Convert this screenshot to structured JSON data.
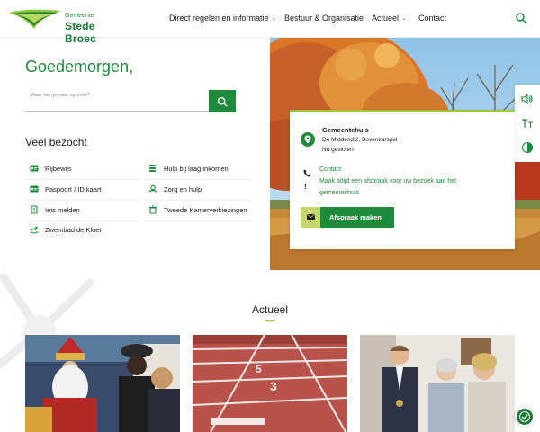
{
  "header": {
    "logo_small": "Gemeente",
    "logo_big": "Stede Broec",
    "nav": [
      {
        "label": "Direct regelen en informatie",
        "has_dropdown": true
      },
      {
        "label": "Bestuur & Organisatie",
        "has_dropdown": false
      },
      {
        "label": "Actueel",
        "has_dropdown": true
      },
      {
        "label": "Contact",
        "has_dropdown": false
      }
    ],
    "search_icon": "search-icon"
  },
  "hero": {
    "greeting": "Goedemorgen,",
    "search_placeholder": "Waar ben je naar op zoek?"
  },
  "meest_bezocht": {
    "title": "Veel bezocht",
    "links": [
      {
        "label": "Rijbewijs",
        "icon": "id-card-icon"
      },
      {
        "label": "Hulp bij laag inkomen",
        "icon": "coins-icon"
      },
      {
        "label": "Paspoort / ID kaart",
        "icon": "id-card-icon"
      },
      {
        "label": "Zorg en hulp",
        "icon": "care-icon"
      },
      {
        "label": "Iets melden",
        "icon": "report-icon"
      },
      {
        "label": "Tweede Kamerverkiezingen",
        "icon": "ballot-box-icon"
      },
      {
        "label": "Zwembad de Kloet",
        "icon": "swimmer-icon"
      }
    ]
  },
  "info_card": {
    "location_name": "Gemeentehuis",
    "address": "De Middend 2, Bovenkarspel",
    "status": "Nu gesloten",
    "contact_label": "Contact",
    "notice_line1": "Maak altijd een afspraak voor uw bezoek aan het",
    "notice_line2": "gemeentehuis",
    "appointment_button": "Afspraak maken"
  },
  "tools": [
    "speaker-icon",
    "text-size-icon",
    "contrast-icon"
  ],
  "actueel": {
    "title": "Actueel",
    "items": [
      {
        "image": "sinterklaas-photo"
      },
      {
        "image": "running-track-photo"
      },
      {
        "image": "mayor-photo"
      }
    ]
  },
  "colors": {
    "brand_green": "#1e8a3c",
    "accent_lime": "#a3c437"
  }
}
